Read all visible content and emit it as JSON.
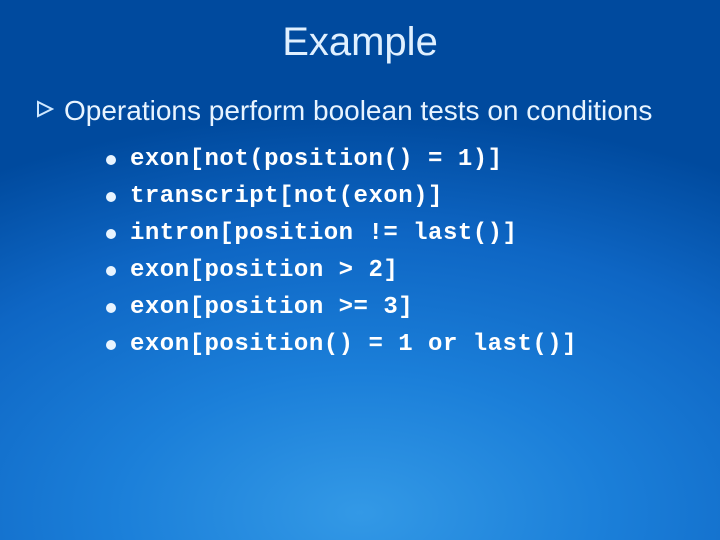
{
  "title": "Example",
  "main_text": "Operations perform boolean tests on conditions",
  "items": [
    "exon[not(position() = 1)]",
    "transcript[not(exon)]",
    "intron[position != last()]",
    "exon[position > 2]",
    "exon[position >= 3]",
    "exon[position() = 1 or last()]"
  ]
}
